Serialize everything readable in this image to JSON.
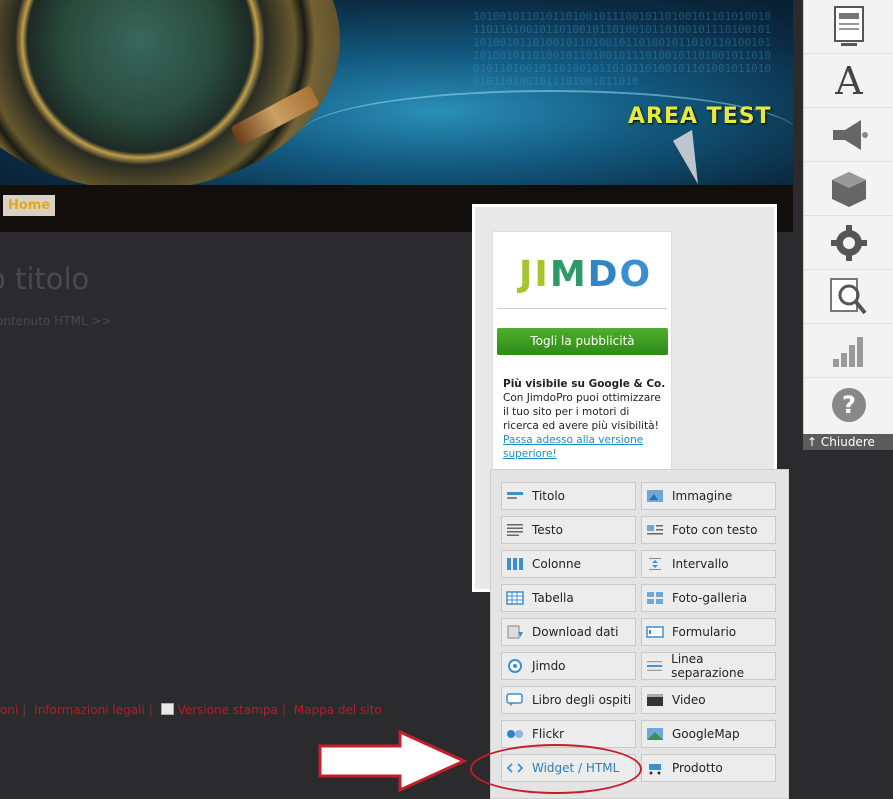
{
  "banner": {
    "title": "AREA TEST"
  },
  "nav": {
    "home_label": "Home"
  },
  "main": {
    "heading": "o titolo",
    "subtext": "ontenuto HTML >>"
  },
  "footer": {
    "links": [
      "oni",
      "Informazioni legali",
      "Versione stampa",
      "Mappa del sito"
    ]
  },
  "ad": {
    "logo_text": "JIMDO",
    "button_label": "Togli la pubblicità",
    "headline": "Più visibile su Google & Co.",
    "body": "Con JimdoPro puoi ottimizzare il tuo sito per i motori di ricerca ed avere più visibilità! ",
    "link_text": "Passa adesso alla versione superiore!"
  },
  "elements": {
    "left": [
      "Titolo",
      "Testo",
      "Colonne",
      "Tabella",
      "Download dati",
      "Jimdo",
      "Libro degli ospiti",
      "Flickr",
      "Widget / HTML"
    ],
    "right": [
      "Immagine",
      "Foto con testo",
      "Intervallo",
      "Foto-galleria",
      "Formulario",
      "Linea separazione",
      "Video",
      "GoogleMap",
      "Prodotto"
    ]
  },
  "toolbar": {
    "close_label": "Chiudere",
    "icons": [
      "layout-icon",
      "font-icon",
      "megaphone-icon",
      "package-icon",
      "gear-icon",
      "seo-magnifier-icon",
      "statistics-icon",
      "help-icon"
    ]
  },
  "colors": {
    "accent_link": "#2b7fb7",
    "footer_link": "#c0172b",
    "annotation": "#c41e2c"
  }
}
